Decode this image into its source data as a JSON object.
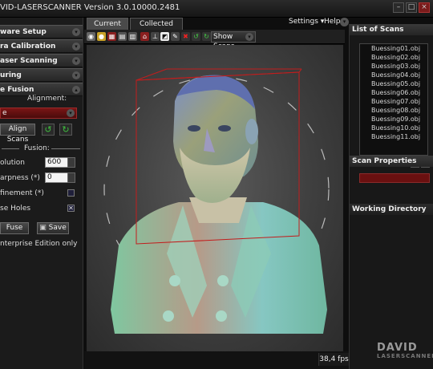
{
  "window": {
    "title": "VID-LASERSCANNER Version 3.0.10000.2481",
    "controls": [
      "–",
      "□",
      "×"
    ]
  },
  "left_panel": {
    "sections": [
      "ware Setup",
      "ra Calibration",
      "aser Scanning",
      "uring",
      "e Fusion"
    ],
    "alignment_label": "Alignment:",
    "alignment_dropdown": "e",
    "align_scans_button": "Align Scans",
    "fusion_label": "Fusion:",
    "resolution_label": "olution",
    "resolution_value": "600",
    "sharpness_label": "arpness  (*)",
    "sharpness_value": "0",
    "refinement_label": "finement  (*)",
    "close_holes_label": "se Holes",
    "fuse_button": "Fuse",
    "save_button": "Save",
    "edition_note": "nterprise Edition only"
  },
  "center": {
    "tabs": [
      "Current Scan",
      "Collected Scans"
    ],
    "show_scans_label": "Show Scans",
    "fps": "38,4 fps"
  },
  "top_menu": {
    "settings": "Settings ▾",
    "help": "Help ▾"
  },
  "right_panel": {
    "list_title": "List of Scans",
    "scans": [
      "Buessing01.obj",
      "Buessing02.obj",
      "Buessing03.obj",
      "Buessing04.obj",
      "Buessing05.obj",
      "Buessing06.obj",
      "Buessing07.obj",
      "Buessing08.obj",
      "Buessing09.obj",
      "Buessing10.obj",
      "Buessing11.obj"
    ],
    "properties_title": "Scan Properties",
    "working_dir_title": "Working Directory"
  },
  "logo": {
    "line1": "DAVID",
    "line2": "LASERSCANNER"
  },
  "colors": {
    "accent_red": "#7a1515",
    "panel": "#1b1b1b",
    "viewport": "#3e3e3e"
  }
}
